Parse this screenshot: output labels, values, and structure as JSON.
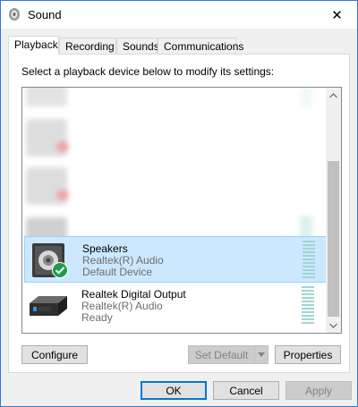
{
  "window": {
    "title": "Sound",
    "close_glyph": "✕"
  },
  "tabs": [
    {
      "label": "Playback"
    },
    {
      "label": "Recording"
    },
    {
      "label": "Sounds"
    },
    {
      "label": "Communications"
    }
  ],
  "instructions": "Select a playback device below to modify its settings:",
  "devices": [
    {
      "name": "Speakers",
      "subtitle": "Realtek(R) Audio",
      "status": "Default Device"
    },
    {
      "name": "Realtek Digital Output",
      "subtitle": "Realtek(R) Audio",
      "status": "Ready"
    }
  ],
  "panel_buttons": {
    "configure": "Configure",
    "set_default": "Set Default",
    "properties": "Properties"
  },
  "dialog_buttons": {
    "ok": "OK",
    "cancel": "Cancel",
    "apply": "Apply"
  },
  "colors": {
    "accent": "#0078d7",
    "selection": "#cce8ff",
    "default_check": "#1e9c4c"
  }
}
